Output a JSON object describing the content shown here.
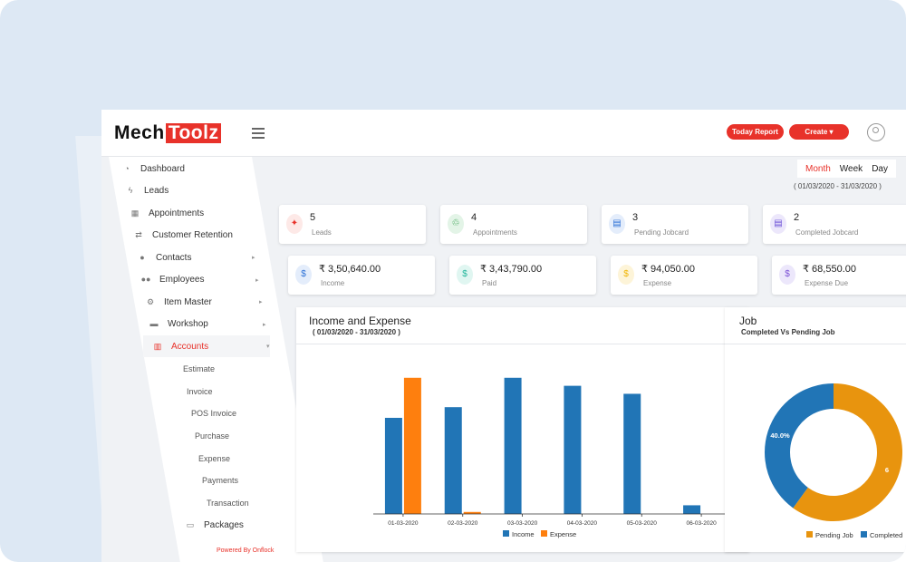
{
  "brand": {
    "part1": "Mech",
    "part2": "Toolz"
  },
  "header": {
    "today_report": "Today Report",
    "create": "Create ▾"
  },
  "sidebar": {
    "items": [
      {
        "label": "Dashboard",
        "icon": "dashboard-icon"
      },
      {
        "label": "Leads",
        "icon": "bolt-icon"
      },
      {
        "label": "Appointments",
        "icon": "calendar-icon"
      },
      {
        "label": "Customer Retention",
        "icon": "retweet-icon"
      },
      {
        "label": "Contacts",
        "icon": "user-icon"
      },
      {
        "label": "Employees",
        "icon": "users-icon"
      },
      {
        "label": "Item Master",
        "icon": "cogs-icon"
      },
      {
        "label": "Workshop",
        "icon": "car-icon"
      },
      {
        "label": "Accounts",
        "icon": "bar-chart-icon"
      }
    ],
    "subitems": [
      "Estimate",
      "Invoice",
      "POS Invoice",
      "Purchase",
      "Expense",
      "Payments",
      "Transaction"
    ],
    "packages": "Packages",
    "powered": "Powered By Onflock"
  },
  "range": {
    "month": "Month",
    "week": "Week",
    "day": "Day",
    "dates": "( 01/03/2020 - 31/03/2020 )"
  },
  "stats_row1": [
    {
      "value": "5",
      "label": "Leads",
      "color": "#e8322a",
      "icon": "leads-icon"
    },
    {
      "value": "4",
      "label": "Appointments",
      "color": "#2e9e4a",
      "icon": "appointments-icon"
    },
    {
      "value": "3",
      "label": "Pending Jobcard",
      "color": "#2a6fd6",
      "icon": "jobcard-icon"
    },
    {
      "value": "2",
      "label": "Completed Jobcard",
      "color": "#6a4fd6",
      "icon": "jobcard-done-icon"
    }
  ],
  "stats_row2": [
    {
      "value": "₹ 3,50,640.00",
      "label": "Income",
      "color": "#2a6fd6",
      "icon": "money-bag-icon"
    },
    {
      "value": "₹ 3,43,790.00",
      "label": "Paid",
      "color": "#1fb59a",
      "icon": "money-bag-icon"
    },
    {
      "value": "₹ 94,050.00",
      "label": "Expense",
      "color": "#f0b400",
      "icon": "money-bag-icon"
    },
    {
      "value": "₹ 68,550.00",
      "label": "Expense Due",
      "color": "#7a4fd6",
      "icon": "money-bag-icon"
    }
  ],
  "income_panel": {
    "title": "Income and Expense",
    "subtitle": "( 01/03/2020 - 31/03/2020 )"
  },
  "job_panel": {
    "title": "Job",
    "subtitle": "Completed Vs Pending Job"
  },
  "chart_data": [
    {
      "type": "bar",
      "categories": [
        "01-03-2020",
        "02-03-2020",
        "03-03-2020",
        "04-03-2020",
        "05-03-2020",
        "06-03-2020"
      ],
      "series": [
        {
          "name": "Income",
          "color": "#2175b6",
          "values": [
            72000,
            80000,
            102000,
            96000,
            90000,
            6500
          ]
        },
        {
          "name": "Expense",
          "color": "#fe7f0e",
          "values": [
            102000,
            1500,
            0,
            0,
            0,
            0
          ]
        }
      ],
      "ylim": [
        0,
        110000
      ]
    },
    {
      "type": "pie",
      "labels": [
        "Pending Job",
        "Completed"
      ],
      "values": [
        60,
        40
      ],
      "colors": [
        "#e8940e",
        "#2175b6"
      ],
      "data_labels": [
        "6",
        "40.0%"
      ],
      "legend": "bottom"
    }
  ]
}
